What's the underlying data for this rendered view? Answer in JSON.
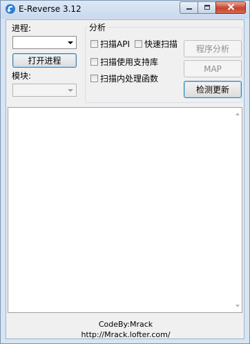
{
  "window": {
    "title": "E-Reverse 3.12"
  },
  "left_panel": {
    "process_label": "进程:",
    "process_combo_value": "",
    "open_process_button": "打开进程",
    "module_label": "模块:",
    "module_combo_value": ""
  },
  "analysis_group": {
    "title": "分析",
    "checkboxes": [
      {
        "label": "扫描API",
        "checked": false
      },
      {
        "label": "快速扫描",
        "checked": false
      },
      {
        "label": "扫描使用支持库",
        "checked": false
      },
      {
        "label": "扫描内处理函数",
        "checked": false
      }
    ],
    "buttons": {
      "program_analysis": "程序分析",
      "map": "MAP",
      "check_update": "检测更新"
    }
  },
  "output_log": {
    "text": ""
  },
  "footer": {
    "credit": "CodeBy:Mrack",
    "url": "http://Mrack.lofter.com/"
  },
  "colors": {
    "window_frame": "#d8e4f2",
    "client_bg": "#f0f0f0",
    "close_button": "#c7422c",
    "disabled_text": "#8d8d8d"
  },
  "icons": {
    "app": "e-reverse-app-icon",
    "minimize": "minimize-icon",
    "maximize": "maximize-icon",
    "close": "close-icon"
  }
}
